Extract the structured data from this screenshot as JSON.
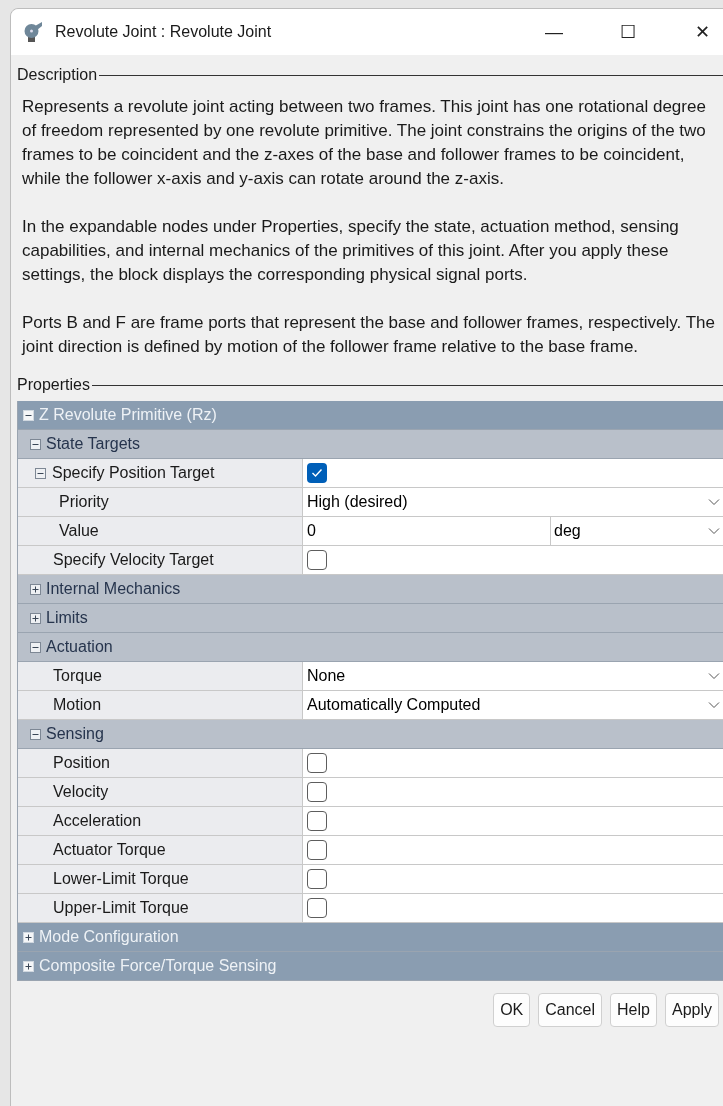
{
  "window": {
    "title": "Revolute Joint : Revolute Joint",
    "controls": [
      "—",
      "☐",
      "✕"
    ]
  },
  "description": {
    "legend": "Description",
    "paragraphs": [
      "Represents a revolute joint acting between two frames. This joint has one rotational degree of freedom represented by one revolute primitive. The joint constrains the origins of the two frames to be coincident and the z-axes of the base and follower frames to be coincident, while the follower x-axis and y-axis can rotate around the z-axis.",
      "In the expandable nodes under Properties, specify the state, actuation method, sensing capabilities, and internal mechanics of the primitives of this joint. After you apply these settings, the block displays the corresponding physical signal ports.",
      "Ports B and F are frame ports that represent the base and follower frames, respectively. The joint direction is defined by motion of the follower frame relative to the base frame."
    ]
  },
  "properties": {
    "legend": "Properties",
    "tree": [
      {
        "kind": "group",
        "label": "Z Revolute Primitive (Rz)",
        "expanded": true,
        "children": [
          {
            "kind": "group",
            "label": "State Targets",
            "expanded": true,
            "children": [
              {
                "kind": "checkbox",
                "label": "Specify Position Target",
                "checked": true,
                "expanded": true,
                "children": [
                  {
                    "kind": "dropdown",
                    "label": "Priority",
                    "value": "High (desired)"
                  },
                  {
                    "kind": "value_unit",
                    "label": "Value",
                    "value": "0",
                    "unit": "deg"
                  }
                ]
              },
              {
                "kind": "checkbox",
                "label": "Specify Velocity Target",
                "checked": false
              }
            ]
          },
          {
            "kind": "group",
            "label": "Internal Mechanics",
            "expanded": false
          },
          {
            "kind": "group",
            "label": "Limits",
            "expanded": false
          },
          {
            "kind": "group",
            "label": "Actuation",
            "expanded": true,
            "children": [
              {
                "kind": "dropdown",
                "label": "Torque",
                "value": "None"
              },
              {
                "kind": "dropdown",
                "label": "Motion",
                "value": "Automatically Computed"
              }
            ]
          },
          {
            "kind": "group",
            "label": "Sensing",
            "expanded": true,
            "children": [
              {
                "kind": "checkbox",
                "label": "Position",
                "checked": false
              },
              {
                "kind": "checkbox",
                "label": "Velocity",
                "checked": false
              },
              {
                "kind": "checkbox",
                "label": "Acceleration",
                "checked": false
              },
              {
                "kind": "checkbox",
                "label": "Actuator Torque",
                "checked": false
              },
              {
                "kind": "checkbox",
                "label": "Lower-Limit Torque",
                "checked": false
              },
              {
                "kind": "checkbox",
                "label": "Upper-Limit Torque",
                "checked": false
              }
            ]
          }
        ]
      },
      {
        "kind": "group",
        "label": "Mode Configuration",
        "expanded": false
      },
      {
        "kind": "group",
        "label": "Composite Force/Torque Sensing",
        "expanded": false
      }
    ]
  },
  "buttons": [
    "OK",
    "Cancel",
    "Help",
    "Apply"
  ]
}
